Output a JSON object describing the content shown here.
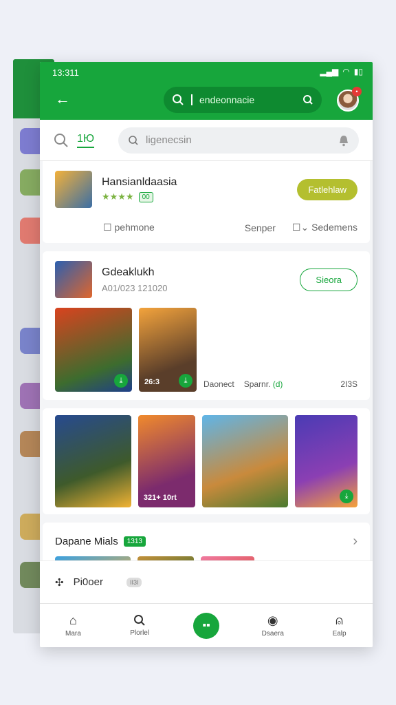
{
  "status": {
    "time": "13:311"
  },
  "top": {
    "search_text": "endeonnacie"
  },
  "search_row": {
    "tab_label": "1Ю",
    "placeholder": "ligenecsin"
  },
  "app1": {
    "title": "Hansianldaasia",
    "badge": "00",
    "action": "Fatlehlaw",
    "meta": [
      "pehmone",
      "Senper",
      "Sedemens"
    ]
  },
  "app2": {
    "title": "Gdeaklukh",
    "subtitle": "A01/023 121020",
    "action": "Sieora",
    "tile1_caption": "",
    "tile2_caption": "26:3",
    "feature_meta": [
      "Daonect",
      "Sparnr.",
      "(d)",
      "2I3S"
    ]
  },
  "gallery": [
    {
      "caption": ""
    },
    {
      "caption": "321+ 10rt"
    },
    {
      "caption": ""
    },
    {
      "caption": ""
    }
  ],
  "section": {
    "title": "Dapane Mials",
    "count": "1313"
  },
  "pioneer": {
    "label": "Pi0oer",
    "pill": "II3I"
  },
  "nav": [
    {
      "icon": "home-icon",
      "label": "Mara"
    },
    {
      "icon": "search-icon",
      "label": "Plorlel"
    },
    {
      "icon": "grid-icon",
      "label": ""
    },
    {
      "icon": "people-icon",
      "label": "Dsaera"
    },
    {
      "icon": "profile-icon",
      "label": "Ealp"
    }
  ],
  "colors": {
    "brand": "#17a63c",
    "olive": "#b4bf2f"
  }
}
